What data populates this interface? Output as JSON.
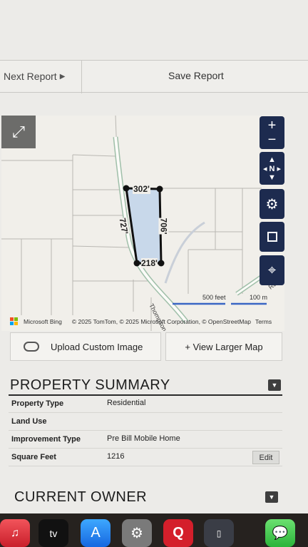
{
  "topbar": {
    "next_report": "Next Report",
    "save_report": "Save Report"
  },
  "map": {
    "parcel_dimensions": {
      "top": "302'",
      "right": "706'",
      "left": "727'",
      "bottom": "218'"
    },
    "road_label": "Thompson Ln",
    "road_label_2": "Rus",
    "scale": {
      "large": "500 feet",
      "small": "100 m"
    },
    "attribution": {
      "bing": "Microsoft Bing",
      "copyright": "© 2025 TomTom, © 2025 Microsoft Corporation, © OpenStreetMap",
      "terms": "Terms"
    },
    "icons": {
      "expand": "expand-icon",
      "zoom_in": "plus-icon",
      "zoom_out": "minus-icon",
      "compass": "compass-icon",
      "settings": "gear-icon",
      "select": "square-select-icon",
      "locate": "crosshair-icon"
    },
    "compass_label": "N",
    "parcel_fill": "#c8d8ea"
  },
  "actions": {
    "upload": "Upload Custom Image",
    "view_larger": "+ View Larger Map"
  },
  "property_summary": {
    "title": "PROPERTY SUMMARY",
    "rows": [
      {
        "label": "Property Type",
        "value": "Residential"
      },
      {
        "label": "Land Use",
        "value": ""
      },
      {
        "label": "Improvement Type",
        "value": "Pre Bill Mobile Home"
      },
      {
        "label": "Square Feet",
        "value": "1216"
      }
    ],
    "edit_label": "Edit"
  },
  "current_owner": {
    "title": "CURRENT OWNER"
  },
  "dock": {
    "tv_label": "tv"
  }
}
